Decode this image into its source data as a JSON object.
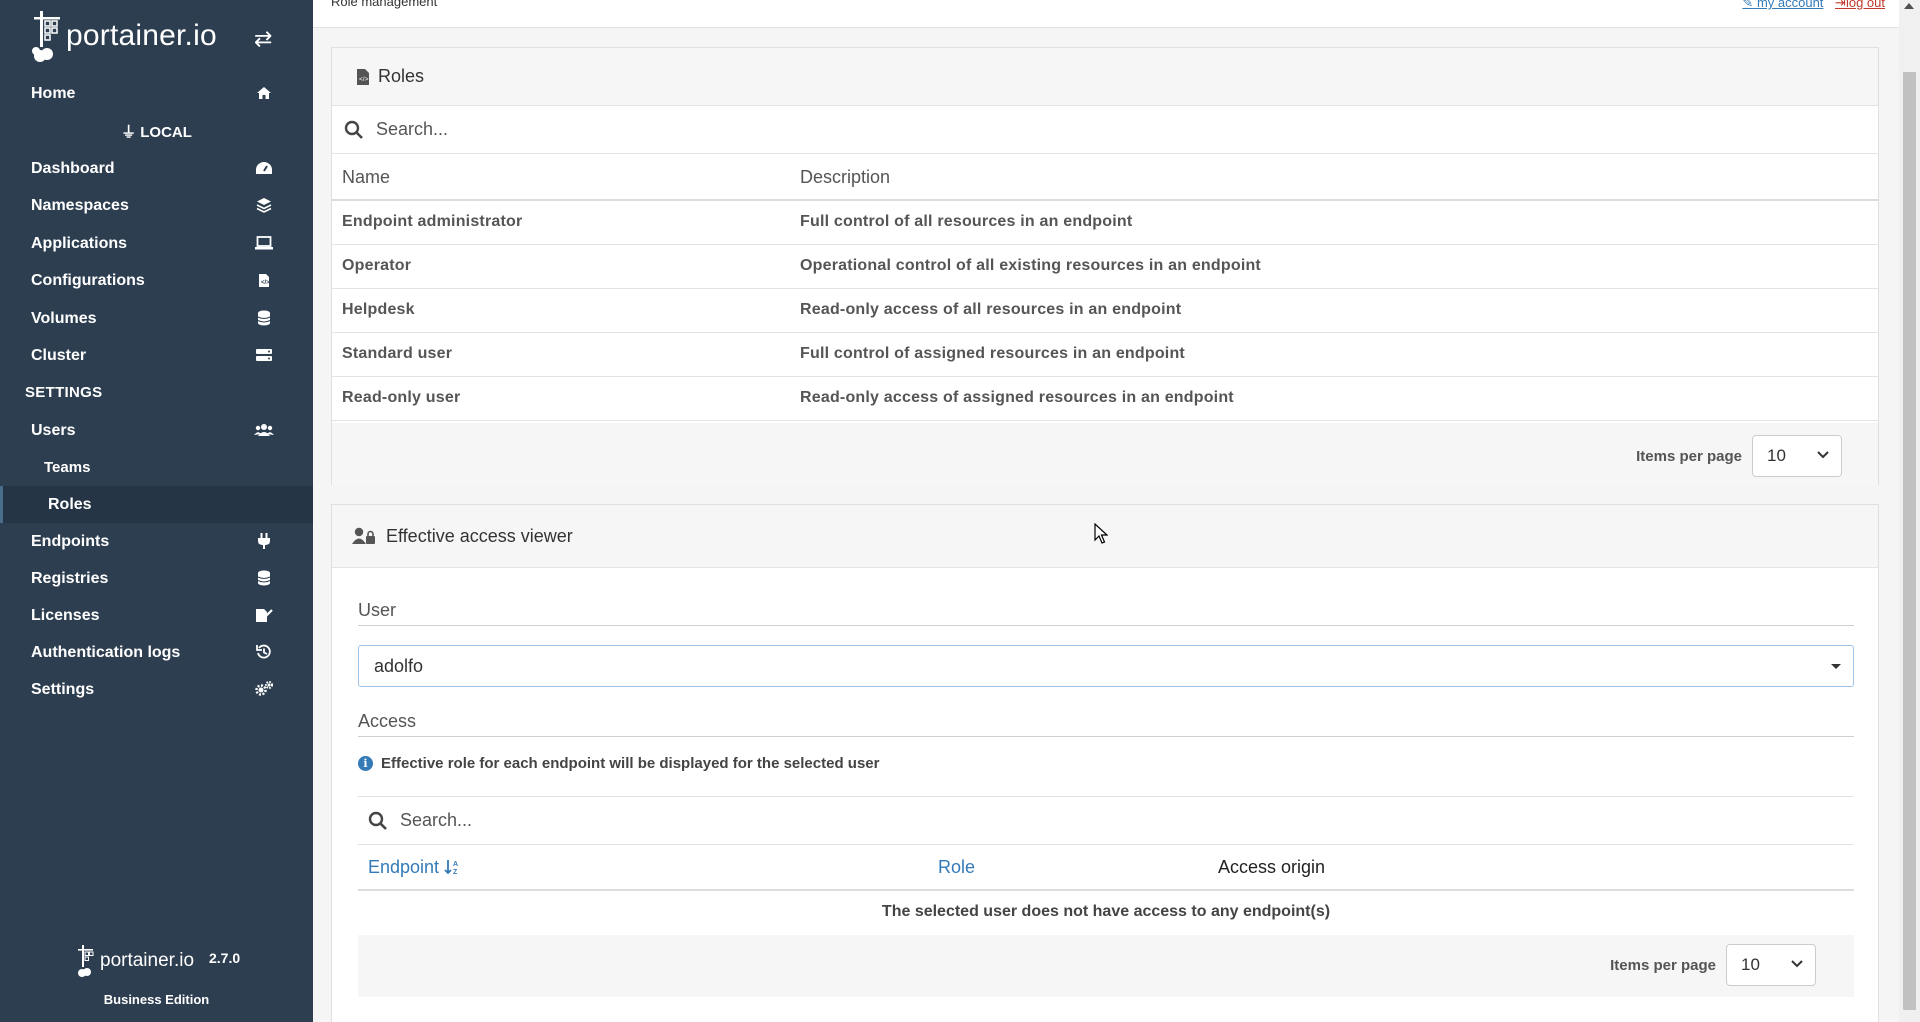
{
  "brand": {
    "name": "portainer.io",
    "toggle_icon": "exchange-icon"
  },
  "sidebar": {
    "home": "Home",
    "endpoint": "LOCAL",
    "items": [
      {
        "label": "Dashboard",
        "icon": "tachometer-icon"
      },
      {
        "label": "Namespaces",
        "icon": "layers-icon"
      },
      {
        "label": "Applications",
        "icon": "laptop-code-icon"
      },
      {
        "label": "Configurations",
        "icon": "file-code-icon"
      },
      {
        "label": "Volumes",
        "icon": "database-icon"
      },
      {
        "label": "Cluster",
        "icon": "server-icon"
      }
    ],
    "settings_heading": "SETTINGS",
    "settings_items": [
      {
        "label": "Users",
        "icon": "users-icon"
      },
      {
        "label": "Teams"
      },
      {
        "label": "Roles",
        "active": true
      },
      {
        "label": "Endpoints",
        "icon": "plug-icon"
      },
      {
        "label": "Registries",
        "icon": "database-icon"
      },
      {
        "label": "Licenses",
        "icon": "file-signature-icon"
      },
      {
        "label": "Authentication logs",
        "icon": "history-icon"
      },
      {
        "label": "Settings",
        "icon": "cogs-icon"
      }
    ],
    "footer": {
      "brand": "portainer.io",
      "version": "2.7.0",
      "edition": "Business Edition"
    }
  },
  "header": {
    "breadcrumb": "Role management",
    "my_account": "my account",
    "log_out": "log out"
  },
  "roles_panel": {
    "title": "Roles",
    "search_placeholder": "Search...",
    "columns": [
      "Name",
      "Description"
    ],
    "rows": [
      {
        "name": "Endpoint administrator",
        "description": "Full control of all resources in an endpoint"
      },
      {
        "name": "Operator",
        "description": "Operational control of all existing resources in an endpoint"
      },
      {
        "name": "Helpdesk",
        "description": "Read-only access of all resources in an endpoint"
      },
      {
        "name": "Standard user",
        "description": "Full control of assigned resources in an endpoint"
      },
      {
        "name": "Read-only user",
        "description": "Read-only access of assigned resources in an endpoint"
      }
    ],
    "items_per_page_label": "Items per page",
    "items_per_page_value": "10"
  },
  "access_panel": {
    "title": "Effective access viewer",
    "user_label": "User",
    "user_value": "adolfo",
    "access_label": "Access",
    "info_text": "Effective role for each endpoint will be displayed for the selected user",
    "search_placeholder": "Search...",
    "columns": {
      "endpoint": "Endpoint",
      "role": "Role",
      "origin": "Access origin"
    },
    "empty_message": "The selected user does not have access to any endpoint(s)",
    "items_per_page_label": "Items per page",
    "items_per_page_value": "10"
  }
}
